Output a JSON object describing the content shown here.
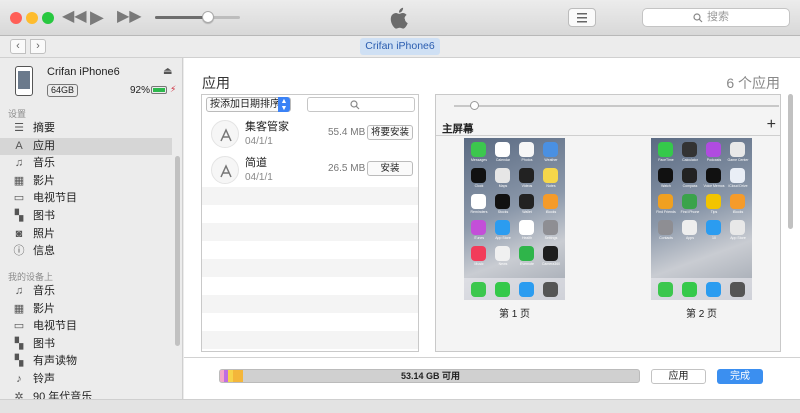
{
  "colors": {
    "accent": "#3b8ff0",
    "pill_bg": "#cfe0f4",
    "battery": "#2db84d"
  },
  "player": {
    "progress": 0.62,
    "prev_icon": "rewind-icon",
    "play_icon": "play-icon",
    "next_icon": "fast-forward-icon"
  },
  "search": {
    "placeholder": "搜索"
  },
  "nav": {
    "back": "‹",
    "forward": "›",
    "device_pill": "Crifan iPhone6"
  },
  "device": {
    "name": "Crifan iPhone6",
    "capacity": "64GB",
    "battery": "92%",
    "battery_level": 0.92
  },
  "sidebar": {
    "settings_header": "设置",
    "settings_items": [
      {
        "label": "摘要",
        "icon": "summary-icon",
        "glyph": "☰"
      },
      {
        "label": "应用",
        "icon": "apps-icon",
        "glyph": "A",
        "selected": true
      },
      {
        "label": "音乐",
        "icon": "music-icon",
        "glyph": "♫"
      },
      {
        "label": "影片",
        "icon": "film-icon",
        "glyph": "▦"
      },
      {
        "label": "电视节目",
        "icon": "tv-icon",
        "glyph": "▭"
      },
      {
        "label": "图书",
        "icon": "book-icon",
        "glyph": "▚"
      },
      {
        "label": "照片",
        "icon": "camera-icon",
        "glyph": "◙"
      },
      {
        "label": "信息",
        "icon": "info-icon",
        "glyph": "ⓘ"
      }
    ],
    "mydevice_header": "我的设备上",
    "device_items": [
      {
        "label": "音乐",
        "icon": "music-icon",
        "glyph": "♫"
      },
      {
        "label": "影片",
        "icon": "film-icon",
        "glyph": "▦"
      },
      {
        "label": "电视节目",
        "icon": "tv-icon",
        "glyph": "▭"
      },
      {
        "label": "图书",
        "icon": "book-icon",
        "glyph": "▚"
      },
      {
        "label": "有声读物",
        "icon": "audiobook-icon",
        "glyph": "▚"
      },
      {
        "label": "铃声",
        "icon": "bell-icon",
        "glyph": "♪"
      },
      {
        "label": "90 年代音乐",
        "icon": "gear-icon",
        "glyph": "✲"
      }
    ]
  },
  "main": {
    "title": "应用",
    "count": "6 个应用",
    "sort": {
      "value": "按添加日期排序"
    },
    "apps": [
      {
        "name": "集客管家",
        "date": "04/1/1",
        "size": "55.4 MB",
        "action": "将要安装"
      },
      {
        "name": "简道",
        "date": "04/1/1",
        "size": "26.5 MB",
        "action": "安装"
      }
    ],
    "home": {
      "title": "主屏幕",
      "zoom": 0.05,
      "pages": [
        {
          "label": "第 1 页",
          "apps": [
            "Messages",
            "Calendar",
            "Photos",
            "Weather",
            "Clock",
            "Maps",
            "Videos",
            "Notes",
            "Reminders",
            "Stocks",
            "Wallet",
            "iBooks",
            "iTunes",
            "App Store",
            "Health",
            "Settings",
            "Music",
            "News",
            "Evernote",
            "Camera360"
          ],
          "colors": [
            "#3cc74e",
            "#ffffff",
            "#f6f6f6",
            "#4a90e2",
            "#111",
            "#e6e6e6",
            "#222",
            "#f6d74a",
            "#fff",
            "#111",
            "#222",
            "#f59b2a",
            "#c34fd8",
            "#2b9cf0",
            "#fff",
            "#8e8e93",
            "#f23c5a",
            "#f0f0f0",
            "#2fb54a",
            "#1e1e1e"
          ],
          "dock": [
            "Phone",
            "WeChat",
            "Safari",
            "Camera"
          ],
          "dock_colors": [
            "#3cc74e",
            "#35c94b",
            "#2b9cf0",
            "#555"
          ]
        },
        {
          "label": "第 2 页",
          "apps": [
            "FaceTime",
            "Calculator",
            "Podcasts",
            "Game Center",
            "Watch",
            "Compass",
            "Voice Memos",
            "iCloud Drive",
            "Find Friends",
            "Find iPhone",
            "Tips",
            "iBooks",
            "Contacts",
            "Apps",
            "10",
            "App Store"
          ],
          "colors": [
            "#35c94b",
            "#333",
            "#b04ce0",
            "#e8e8e8",
            "#111",
            "#222",
            "#111",
            "#e9eef6",
            "#f0a020",
            "#3aa34b",
            "#f2c400",
            "#f59b2a",
            "#8e8e93",
            "#eee",
            "#2b9cf0",
            "#e8e8e8"
          ],
          "dock": [
            "Phone",
            "WeChat",
            "Safari",
            "Camera"
          ],
          "dock_colors": [
            "#3cc74e",
            "#35c94b",
            "#2b9cf0",
            "#555"
          ]
        }
      ]
    }
  },
  "footer": {
    "storage": "53.14 GB 可用",
    "segments": [
      {
        "color": "#f4a6c8",
        "frac": 0.01
      },
      {
        "color": "#c06ee0",
        "frac": 0.01
      },
      {
        "color": "#f7d34a",
        "frac": 0.01
      },
      {
        "color": "#f4b63a",
        "frac": 0.025
      }
    ],
    "apply": "应用",
    "done": "完成"
  }
}
